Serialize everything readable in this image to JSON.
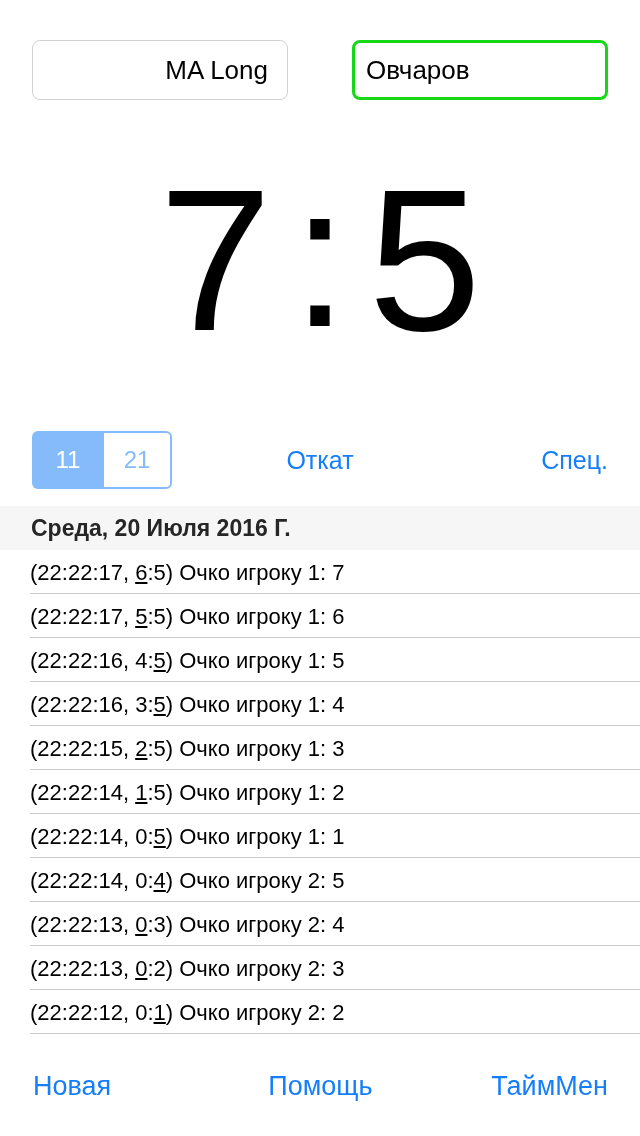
{
  "players": [
    {
      "name": "MA Long",
      "active": false
    },
    {
      "name": "Овчаров",
      "active": true
    }
  ],
  "score": {
    "player_1": "7",
    "divider": ":",
    "player_2": "5"
  },
  "mode_switch": {
    "segments": [
      {
        "label": "11",
        "selected": true
      },
      {
        "label": "21",
        "selected": false
      }
    ]
  },
  "actions": [
    "Откат",
    "Спец."
  ],
  "log": {
    "date": "Среда, 20 Июля 2016 Г.",
    "entries": [
      {
        "segments": [
          {
            "text": "(22:22:17, ",
            "underlined": false
          },
          {
            "text": "6",
            "underlined": true
          },
          {
            "text": ":5) Очко игроку 1: 7",
            "underlined": false
          }
        ]
      },
      {
        "segments": [
          {
            "text": "(22:22:17, ",
            "underlined": false
          },
          {
            "text": "5",
            "underlined": true
          },
          {
            "text": ":5) Очко игроку 1: 6",
            "underlined": false
          }
        ]
      },
      {
        "segments": [
          {
            "text": "(22:22:16, 4:",
            "underlined": false
          },
          {
            "text": "5",
            "underlined": true
          },
          {
            "text": ") Очко игроку 1: 5",
            "underlined": false
          }
        ]
      },
      {
        "segments": [
          {
            "text": "(22:22:16, 3:",
            "underlined": false
          },
          {
            "text": "5",
            "underlined": true
          },
          {
            "text": ") Очко игроку 1: 4",
            "underlined": false
          }
        ]
      },
      {
        "segments": [
          {
            "text": "(22:22:15, ",
            "underlined": false
          },
          {
            "text": "2",
            "underlined": true
          },
          {
            "text": ":5) Очко игроку 1: 3",
            "underlined": false
          }
        ]
      },
      {
        "segments": [
          {
            "text": "(22:22:14, ",
            "underlined": false
          },
          {
            "text": "1",
            "underlined": true
          },
          {
            "text": ":5) Очко игроку 1: 2",
            "underlined": false
          }
        ]
      },
      {
        "segments": [
          {
            "text": "(22:22:14, 0:",
            "underlined": false
          },
          {
            "text": "5",
            "underlined": true
          },
          {
            "text": ") Очко игроку 1: 1",
            "underlined": false
          }
        ]
      },
      {
        "segments": [
          {
            "text": "(22:22:14, 0:",
            "underlined": false
          },
          {
            "text": "4",
            "underlined": true
          },
          {
            "text": ") Очко игроку 2: 5",
            "underlined": false
          }
        ]
      },
      {
        "segments": [
          {
            "text": "(22:22:13, ",
            "underlined": false
          },
          {
            "text": "0",
            "underlined": true
          },
          {
            "text": ":3) Очко игроку 2: 4",
            "underlined": false
          }
        ]
      },
      {
        "segments": [
          {
            "text": "(22:22:13, ",
            "underlined": false
          },
          {
            "text": "0",
            "underlined": true
          },
          {
            "text": ":2) Очко игроку 2: 3",
            "underlined": false
          }
        ]
      },
      {
        "segments": [
          {
            "text": "(22:22:12, 0:",
            "underlined": false
          },
          {
            "text": "1",
            "underlined": true
          },
          {
            "text": ") Очко игроку 2: 2",
            "underlined": false
          }
        ]
      }
    ]
  },
  "toolbar": [
    "Новая",
    "Помощь",
    "ТаймМен"
  ]
}
